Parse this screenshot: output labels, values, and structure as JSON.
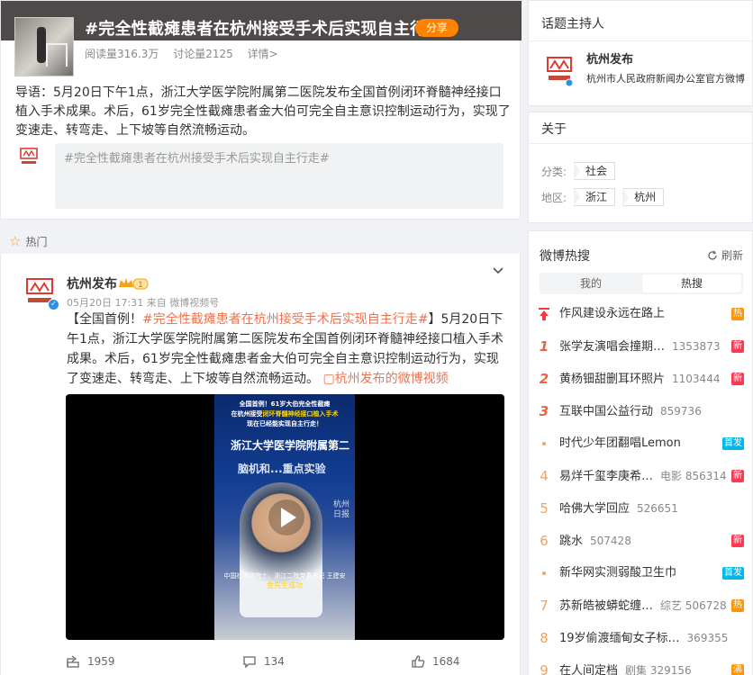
{
  "topic": {
    "title": "#完全性截瘫患者在杭州接受手术后实现自主行走#",
    "share_label": "分享",
    "reads": "阅读量316.3万",
    "discussions": "讨论量2125",
    "details": "详情>",
    "intro": "导语：5月20日下午1点，浙江大学医学院附属第二医院发布全国首例闭环脊髓神经接口植入手术成果。术后，61岁完全性截瘫患者金大伯可完全自主意识控制运动行为，实现了变速走、转弯走、上下坡等自然流畅运动。",
    "quote_placeholder": "#完全性截瘫患者在杭州接受手术后实现自主行走#"
  },
  "hot_label": "热门",
  "post": {
    "author": "杭州发布",
    "level": "1",
    "time": "05月20日 17:31",
    "source": "来自 微博视频号",
    "text_prefix": "【全国首例！",
    "text_tag": "#完全性截瘫患者在杭州接受手术后实现自主行走#",
    "text_body": "】5月20日下午1点，浙江大学医学院附属第二医院发布全国首例闭环脊髓神经接口植入手术成果。术后，61岁完全性截瘫患者金大伯可完全自主意识控制运动行为，实现了变速走、转弯走、上下坡等自然流畅运动。",
    "video_link": "杭州发布的微博视频",
    "video": {
      "caption_line1": "全国首例！61岁大伯完全性截瘫",
      "caption_line2_pre": "在杭州接受",
      "caption_line2_hl": "闭环脊髓神经接口植入手术",
      "caption_line3": "现在已经能实现自主行走！",
      "sign1": "浙江大学医学院附属第二",
      "sign2": "脑机和...重点实验",
      "watermark": "杭州\n日报",
      "sub1": "中国社学院院士、浙江二院党委书记 王建安",
      "sub2": "金先生成功"
    },
    "reposts": "1959",
    "comments": "134",
    "likes": "1684"
  },
  "host": {
    "title": "话题主持人",
    "name": "杭州发布",
    "desc": "杭州市人民政府新闻办公室官方微博"
  },
  "about": {
    "title": "关于",
    "category_label": "分类:",
    "category": "社会",
    "region_label": "地区:",
    "regions": [
      "浙江",
      "杭州"
    ]
  },
  "hot_search": {
    "title": "微博热搜",
    "refresh": "刷新",
    "tab_mine": "我的",
    "tab_hot": "热搜",
    "items": [
      {
        "rank": "",
        "text": "作风建设永远在路上",
        "count": "",
        "badge": "热",
        "badge_type": "hot",
        "pinned": true
      },
      {
        "rank": "1",
        "text": "张学友演唱会撞期…",
        "count": "1353873",
        "badge": "新",
        "badge_type": "new"
      },
      {
        "rank": "2",
        "text": "黄杨钿甜删耳环照片",
        "count": "1103444",
        "badge": "新",
        "badge_type": "new"
      },
      {
        "rank": "3",
        "text": "互联中国公益行动",
        "count": "859736",
        "badge": "",
        "badge_type": ""
      },
      {
        "rank": "•",
        "text": "时代少年团翻唱Lemon",
        "count": "",
        "badge": "首发",
        "badge_type": "first"
      },
      {
        "rank": "4",
        "text": "易烊千玺李庚希…",
        "count": "电影 856314",
        "badge": "新",
        "badge_type": "new"
      },
      {
        "rank": "5",
        "text": "哈佛大学回应",
        "count": "526651",
        "badge": "",
        "badge_type": ""
      },
      {
        "rank": "6",
        "text": "跳水",
        "count": "507428",
        "badge": "新",
        "badge_type": "new"
      },
      {
        "rank": "•",
        "text": "新华网实测弱酸卫生巾",
        "count": "",
        "badge": "首发",
        "badge_type": "first"
      },
      {
        "rank": "7",
        "text": "苏新皓被蟒蛇缠…",
        "count": "综艺 506728",
        "badge": "热",
        "badge_type": "hot"
      },
      {
        "rank": "8",
        "text": "19岁偷渡缅甸女子标…",
        "count": "369355",
        "badge": "",
        "badge_type": ""
      },
      {
        "rank": "9",
        "text": "在人间定档",
        "count": "剧集 329156",
        "badge": "沸",
        "badge_type": "hot"
      }
    ]
  },
  "colors": {
    "accent": "#ff8200",
    "link": "#eb7350",
    "hot_badge": "#ff9406",
    "new_badge": "#ff3852",
    "first_badge": "#00b7ee"
  }
}
